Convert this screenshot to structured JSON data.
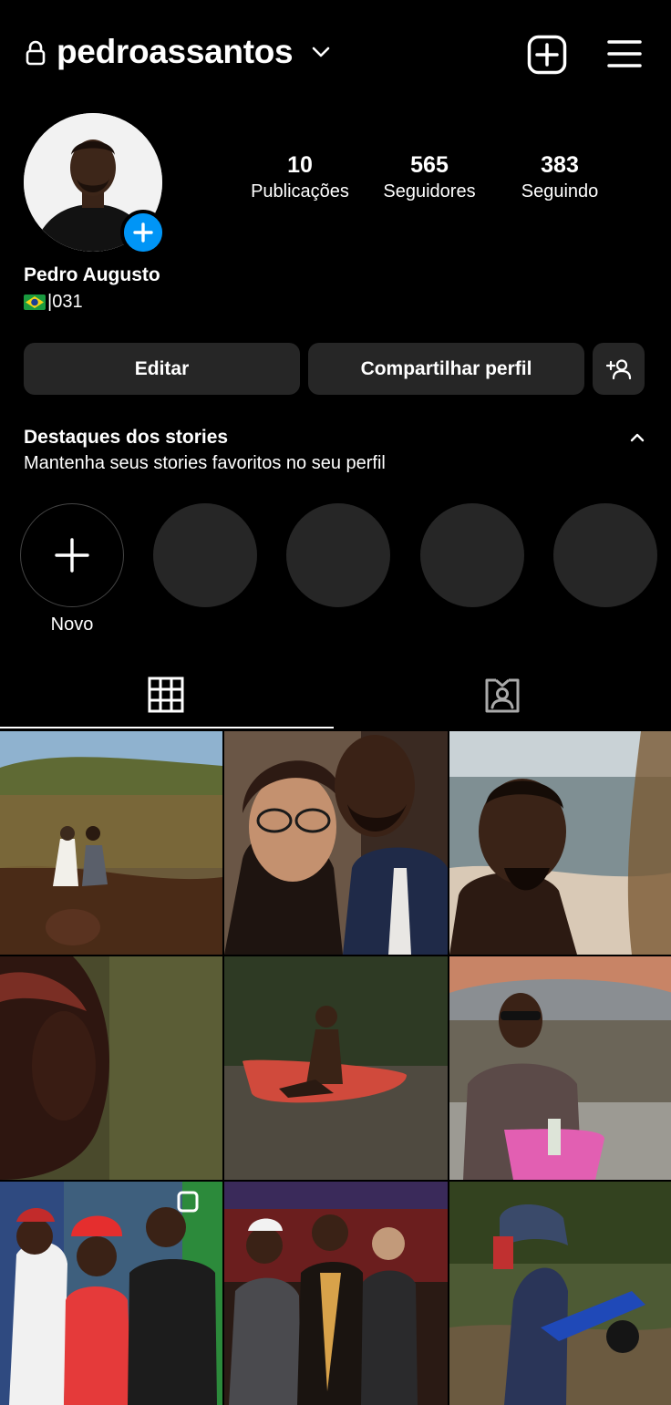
{
  "header": {
    "username": "pedroassantos",
    "icons": [
      "lock-icon",
      "chevron-down-icon",
      "new-post-icon",
      "menu-icon"
    ]
  },
  "profile": {
    "display_name": "Pedro Augusto",
    "bio_text": "|031",
    "bio_flag": "brazil-flag-emoji"
  },
  "stats": [
    {
      "value": "10",
      "label": "Publicações"
    },
    {
      "value": "565",
      "label": "Seguidores"
    },
    {
      "value": "383",
      "label": "Seguindo"
    }
  ],
  "buttons": {
    "edit": "Editar",
    "share": "Compartilhar perfil"
  },
  "highlights": {
    "title": "Destaques dos stories",
    "subtitle": "Mantenha seus stories favoritos no seu perfil",
    "new_label": "Novo"
  },
  "tabs": [
    "grid-icon",
    "tagged-icon"
  ],
  "colors": {
    "background": "#000000",
    "button_bg": "#262626",
    "accent_blue": "#0095f6"
  }
}
